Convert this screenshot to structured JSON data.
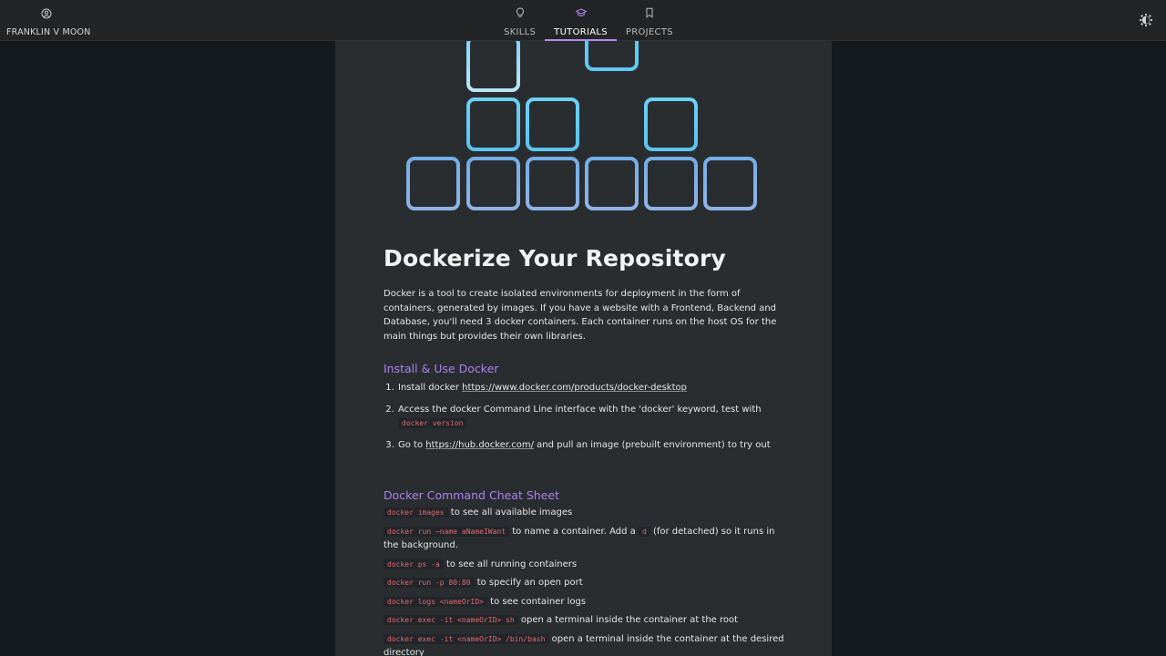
{
  "header": {
    "brand": "FRANKLIN V MOON",
    "nav": [
      {
        "label": "SKILLS",
        "icon": "lightbulb-icon"
      },
      {
        "label": "TUTORIALS",
        "icon": "graduation-cap-icon",
        "active": true
      },
      {
        "label": "PROJECTS",
        "icon": "bookmark-icon"
      }
    ]
  },
  "colors": {
    "accent": "#b58bf0",
    "heading_link": "#a982ee",
    "code_text": "#e26b6b",
    "page_bg": "#141a1e",
    "column_bg": "#2a2d30"
  },
  "article": {
    "title": "Dockerize Your Repository",
    "intro": "Docker is a tool to create isolated environments for deployment in the form of containers, generated by images. If you have a website with a Frontend, Backend and Database, you'll need 3 docker containers. Each container runs on the host OS for the main things but provides their own libraries.",
    "install_heading": "Install & Use Docker",
    "steps": [
      {
        "pre": "Install docker ",
        "link": "https://www.docker.com/products/docker-desktop"
      },
      {
        "pre": "Access the docker Command Line interface with the 'docker' keyword, test with ",
        "code": "docker version"
      },
      {
        "pre": "Go to ",
        "link": "https://hub.docker.com/",
        "post": " and pull an image (prebuilt environment) to try out"
      }
    ],
    "cheat_heading": "Docker Command Cheat Sheet",
    "cheats": [
      {
        "code": "docker images",
        "text": " to see all available images"
      },
      {
        "code": "docker run —name aNameIWant",
        "text": " to name a container. Add a ",
        "code2": "d",
        "text2": " (for detached) so it runs in the background."
      },
      {
        "code": "docker ps -a",
        "text": " to see all running containers"
      },
      {
        "code": "docker run -p 80:80",
        "text": " to specify an open port"
      },
      {
        "code": "docker logs <nameOrID>",
        "text": " to see container logs"
      },
      {
        "code": "docker exec -it <nameOrID> sh",
        "text": " open a terminal inside the container at the root"
      },
      {
        "code": "docker exec -it <nameOrID> /bin/bash",
        "text": " open a terminal inside the container at the desired directory"
      }
    ]
  }
}
